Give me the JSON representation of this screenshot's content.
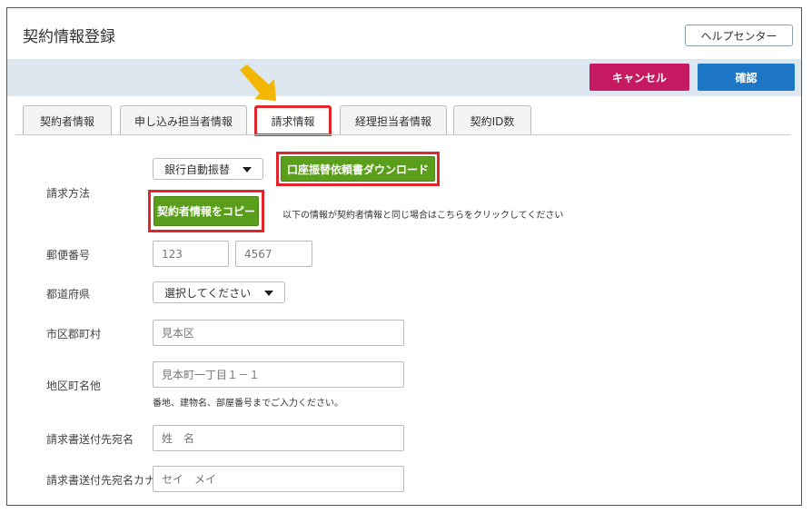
{
  "header": {
    "title": "契約情報登録",
    "help_label": "ヘルプセンター"
  },
  "actions": {
    "cancel_label": "キャンセル",
    "confirm_label": "確認",
    "cancel_color": "#c61a62",
    "confirm_color": "#1d77c6"
  },
  "tabs": [
    {
      "label": "契約者情報"
    },
    {
      "label": "申し込み担当者情報"
    },
    {
      "label": "請求情報",
      "active": true
    },
    {
      "label": "経理担当者情報"
    },
    {
      "label": "契約ID数"
    }
  ],
  "billing": {
    "method_label": "請求方法",
    "method_value": "銀行自動振替",
    "download_label": "口座振替依頼書ダウンロード",
    "copy_label": "契約者情報をコピー",
    "copy_note": "以下の情報が契約者情報と同じ場合はこちらをクリックしてください"
  },
  "postal": {
    "label": "郵便番号",
    "first_placeholder": "123",
    "second_placeholder": "4567"
  },
  "prefecture": {
    "label": "都道府県",
    "value": "選択してください"
  },
  "city": {
    "label": "市区郡町村",
    "placeholder": "見本区"
  },
  "district": {
    "label": "地区町名他",
    "placeholder": "見本町一丁目１－１",
    "note": "番地、建物名、部屋番号までご入力ください。"
  },
  "recipient_name": {
    "label": "請求書送付先宛名",
    "placeholder": "姓　名"
  },
  "recipient_kana": {
    "label": "請求書送付先宛名カナ",
    "placeholder": "セイ　メイ"
  },
  "highlight_color": "#e0262a",
  "arrow_color": "#f2b705"
}
